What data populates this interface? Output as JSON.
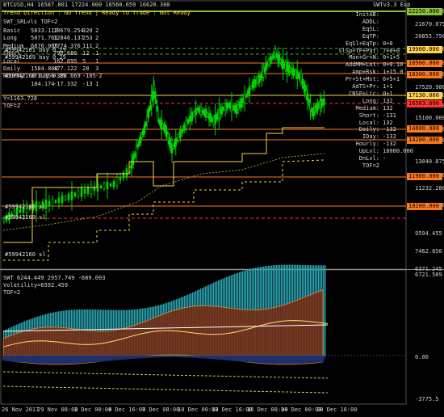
{
  "header": {
    "main_title": "BTCUSD,H4  16587.801 17224.000 16560.659 16620.300",
    "status_line": "Trend Direction : No Trend  |  Ready to Trade : Not Ready",
    "corner": "SWTv3.3  Exp"
  },
  "stats_table": {
    "title": "SWT_SRLvls  TOF=2",
    "rows": [
      [
        "Basic",
        "5833.117",
        "18679.254",
        "320",
        "2"
      ],
      [
        "Long",
        "5071.761",
        "12846.137",
        "253",
        "2"
      ],
      [
        "Medium",
        "6876.086",
        "7774.376",
        "111",
        "2"
      ],
      [
        "Short",
        "",
        "798.686",
        "12",
        "1"
      ],
      [
        "Local",
        "",
        "162.695",
        "5",
        "1"
      ],
      [
        "Daily",
        "1584.868",
        "477.122",
        "28",
        "3"
      ],
      [
        "Hourly",
        "373.356",
        "-390.669",
        "-105",
        "-2"
      ],
      [
        "",
        "184.174",
        "-17.332",
        "-13",
        "1"
      ]
    ],
    "y_line": "Y=1163.728",
    "tof": "TOF=2"
  },
  "side_panel": [
    {
      "label": "InitAB:",
      "value": ""
    },
    {
      "label": "ADDL:",
      "value": ""
    },
    {
      "label": "EqSL:",
      "value": ""
    },
    {
      "label": "EqTP:",
      "value": ""
    },
    {
      "label": "EqSl+EqTp:",
      "value": "0+0"
    },
    {
      "label": "SlSp+TP+Pat:",
      "value": "7+0+0"
    },
    {
      "label": "Mon+Gr+N:",
      "value": "0+1+5"
    },
    {
      "label": "AddMM+Lot:",
      "value": "0+0.10"
    },
    {
      "label": "Amp+Rsk:",
      "value": "1+15.0"
    },
    {
      "label": "Pr+St+Mst:",
      "value": "6+5+1"
    },
    {
      "label": "AdTS+Pr:",
      "value": "1+1"
    },
    {
      "label": "CNSP+Lic:",
      "value": "0+1"
    },
    {
      "label": "Long:",
      "value": "132"
    },
    {
      "label": "Medium:",
      "value": "132"
    },
    {
      "label": "Short:",
      "value": "-131"
    },
    {
      "label": "Local:",
      "value": "132"
    },
    {
      "label": "Daily:",
      "value": "-132"
    },
    {
      "label": "IDay:",
      "value": "-132"
    },
    {
      "label": "Hourly:",
      "value": "-132"
    },
    {
      "label": "UpLvl:",
      "value": "18000.000"
    },
    {
      "label": "DnLvl:",
      "value": "-"
    },
    {
      "label": "TOF=2",
      "value": ""
    }
  ],
  "level_labels": [
    {
      "text": "#59942161 buy 0.25"
    },
    {
      "text": "#59942169 buy 0.25"
    },
    {
      "text": "#59942160 buy 0.25"
    },
    {
      "text": "#59942180 sl"
    },
    {
      "text": "#59942169 sl"
    },
    {
      "text": "#59942160 sl"
    }
  ],
  "price_scale": [
    "22250.000",
    "21670.075",
    "20855.750",
    "19900.000",
    "18900.000",
    "18300.000",
    "17520.980",
    "17130.000",
    "16503.000",
    "15100.000",
    "14800.000",
    "14200.000",
    "13040.875",
    "11900.000",
    "11232.280",
    "10200.000",
    "9594.455",
    "7462.850",
    "6371.245"
  ],
  "price_tags": [
    {
      "text": "22250.000",
      "color": "#8ac43a"
    },
    {
      "text": "19900.000",
      "color": "#ffd24d"
    },
    {
      "text": "18900.000",
      "color": "#ff7a1a"
    },
    {
      "text": "18300.000",
      "color": "#ff7a1a"
    },
    {
      "text": "17130.000",
      "color": "#ffd24d"
    },
    {
      "text": "16503.000",
      "color": "#ff3333"
    },
    {
      "text": "14800.000",
      "color": "#ff7a1a"
    },
    {
      "text": "14200.000",
      "color": "#ff7a1a"
    },
    {
      "text": "11900.000",
      "color": "#ff7a1a"
    },
    {
      "text": "10200.000",
      "color": "#ff7a1a"
    }
  ],
  "indicator": {
    "line1": "SWT 6244.449 2957.749 -689.003",
    "line2": "Volatility=6592.459",
    "line3": "TOF=2",
    "scale": [
      "6721.589",
      "0.00",
      "-3775.5"
    ]
  },
  "time_axis": [
    "26 Nov 2017",
    "29 Nov 08:00",
    "2 Dec 00:00",
    "4 Dec 16:00",
    "7 Dec 08:00",
    "10 Dec 00:00",
    "12 Dec 16:00",
    "15 Dec 08:00",
    "18 Dec 00:00",
    "20 Dec 16:00"
  ],
  "colors": {
    "background": "#000000",
    "bull_candle": "#00d400",
    "bear_candle": "#00d400",
    "support_line": "#ff7a1a",
    "resistance_line": "#ffd24d",
    "stop_line": "#ff3333",
    "top_line": "#8ac43a",
    "buy_line": "#4f9e2f"
  }
}
